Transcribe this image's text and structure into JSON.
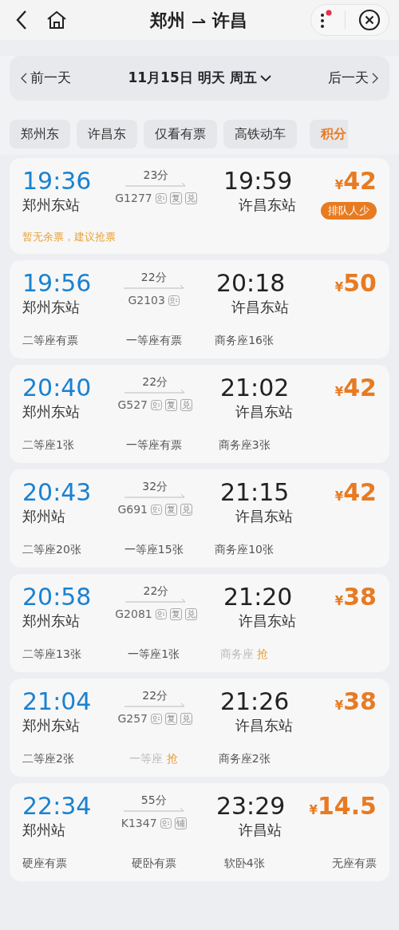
{
  "header": {
    "from": "郑州",
    "to": "许昌",
    "notification": true
  },
  "date_bar": {
    "prev": "前一天",
    "date": "11月15日 明天 周五",
    "next": "后一天"
  },
  "filters": [
    {
      "label": "郑州东",
      "kind": "plain"
    },
    {
      "label": "许昌东",
      "kind": "plain"
    },
    {
      "label": "仅看有票",
      "kind": "plain"
    },
    {
      "label": "高铁动车",
      "kind": "plain"
    },
    {
      "label": "积分",
      "kind": "promo"
    }
  ],
  "trains": [
    {
      "depart": "19:36",
      "depart_station": "郑州东站",
      "duration": "23分",
      "number": "G1277",
      "tags": [
        "复",
        "兑"
      ],
      "arrive": "19:59",
      "arrive_station": "许昌东站",
      "currency": "¥",
      "price": "42",
      "badge": "排队人少",
      "note": "暂无余票，建议抢票"
    },
    {
      "depart": "19:56",
      "depart_station": "郑州东站",
      "duration": "22分",
      "number": "G2103",
      "arrive": "20:18",
      "arrive_station": "许昌东站",
      "currency": "¥",
      "price": "50",
      "seats": [
        {
          "text": "二等座有票",
          "grab": false
        },
        {
          "text": "一等座有票",
          "grab": false
        },
        {
          "text": "商务座16张",
          "grab": false
        }
      ]
    },
    {
      "depart": "20:40",
      "depart_station": "郑州东站",
      "duration": "22分",
      "number": "G527",
      "tags": [
        "复",
        "兑"
      ],
      "arrive": "21:02",
      "arrive_station": "许昌东站",
      "currency": "¥",
      "price": "42",
      "seats": [
        {
          "text": "二等座1张",
          "grab": false
        },
        {
          "text": "一等座有票",
          "grab": false
        },
        {
          "text": "商务座3张",
          "grab": false
        }
      ]
    },
    {
      "depart": "20:43",
      "depart_station": "郑州站",
      "duration": "32分",
      "number": "G691",
      "tags": [
        "复",
        "兑"
      ],
      "arrive": "21:15",
      "arrive_station": "许昌东站",
      "currency": "¥",
      "price": "42",
      "seats": [
        {
          "text": "二等座20张",
          "grab": false
        },
        {
          "text": "一等座15张",
          "grab": false
        },
        {
          "text": "商务座10张",
          "grab": false
        }
      ]
    },
    {
      "depart": "20:58",
      "depart_station": "郑州东站",
      "duration": "22分",
      "number": "G2081",
      "tags": [
        "复",
        "兑"
      ],
      "arrive": "21:20",
      "arrive_station": "许昌东站",
      "currency": "¥",
      "price": "38",
      "seats": [
        {
          "text": "二等座13张",
          "grab": false
        },
        {
          "text": "一等座1张",
          "grab": false
        },
        {
          "text": "商务座",
          "grab": true,
          "action": "抢"
        }
      ]
    },
    {
      "depart": "21:04",
      "depart_station": "郑州东站",
      "duration": "22分",
      "number": "G257",
      "tags": [
        "复",
        "兑"
      ],
      "arrive": "21:26",
      "arrive_station": "许昌东站",
      "currency": "¥",
      "price": "38",
      "seats": [
        {
          "text": "二等座2张",
          "grab": false
        },
        {
          "text": "一等座",
          "grab": true,
          "action": "抢"
        },
        {
          "text": "商务座2张",
          "grab": false
        }
      ]
    },
    {
      "depart": "22:34",
      "depart_station": "郑州站",
      "duration": "55分",
      "number": "K1347",
      "tags": [
        "铺"
      ],
      "arrive": "23:29",
      "arrive_station": "许昌站",
      "currency": "¥",
      "price": "14.5",
      "seats": [
        {
          "text": "硬座有票",
          "grab": false
        },
        {
          "text": "硬卧有票",
          "grab": false
        },
        {
          "text": "软卧4张",
          "grab": false
        },
        {
          "text": "无座有票",
          "grab": false
        }
      ]
    }
  ]
}
